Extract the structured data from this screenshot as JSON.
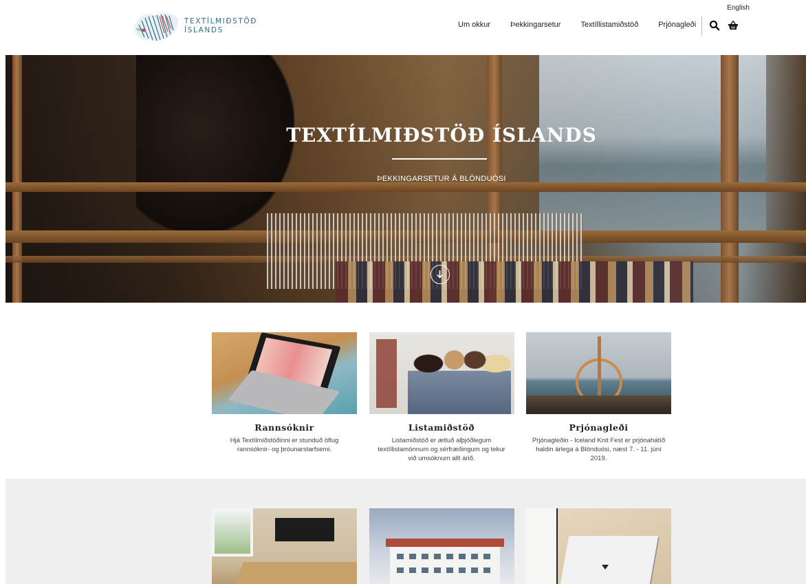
{
  "header": {
    "language_link": "English",
    "logo_line1": "TEXTÍLMIÐSTÖÐ",
    "logo_line2": "ÍSLANDS",
    "nav": [
      "Um okkur",
      "Þekkingarsetur",
      "Textíllistamiðstöð",
      "Prjónagleði"
    ],
    "icons": [
      "search-icon",
      "basket-icon"
    ]
  },
  "hero": {
    "title": "TEXTÍLMIÐSTÖÐ ÍSLANDS",
    "subtitle": "ÞEKKINGARSETUR Á BLÖNDUÓSI",
    "scroll_icon": "arrow-down-circle-icon"
  },
  "cards_row1": [
    {
      "title": "Rannsóknir",
      "desc": "Hjá Textílmiðstöðinni er stunduð öflug rannsóknir- og þróunarstarfsemi."
    },
    {
      "title": "Listamiðstöð",
      "desc": "Listamiðstöð er ætluð alþjóðlegum textíllistamönnum og sérfræðingum og tekur við umsóknum allt árið."
    },
    {
      "title": "Prjónagleði",
      "desc": "Prjónagleðin - Iceland Knit Fest er prjónahátíð haldin árlega á Blönduósi, næst 7. - 11. júní 2019."
    }
  ],
  "colors": {
    "logo_teal": "#2e6f86",
    "band_background": "#f0f0f0"
  }
}
